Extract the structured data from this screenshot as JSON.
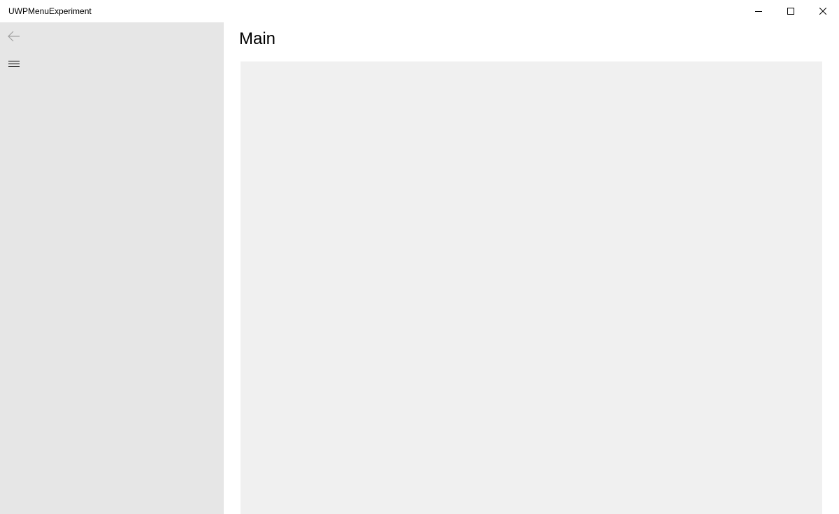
{
  "window": {
    "title": "UWPMenuExperiment"
  },
  "caption_buttons": {
    "minimize_icon": "minimize-icon",
    "maximize_icon": "maximize-icon",
    "close_icon": "close-icon"
  },
  "nav": {
    "back_icon": "back-arrow-icon",
    "menu_icon": "hamburger-icon"
  },
  "main": {
    "title": "Main"
  },
  "colors": {
    "pane_background": "#e6e6e6",
    "content_frame_background": "#f0f0f0",
    "window_background": "#ffffff"
  }
}
